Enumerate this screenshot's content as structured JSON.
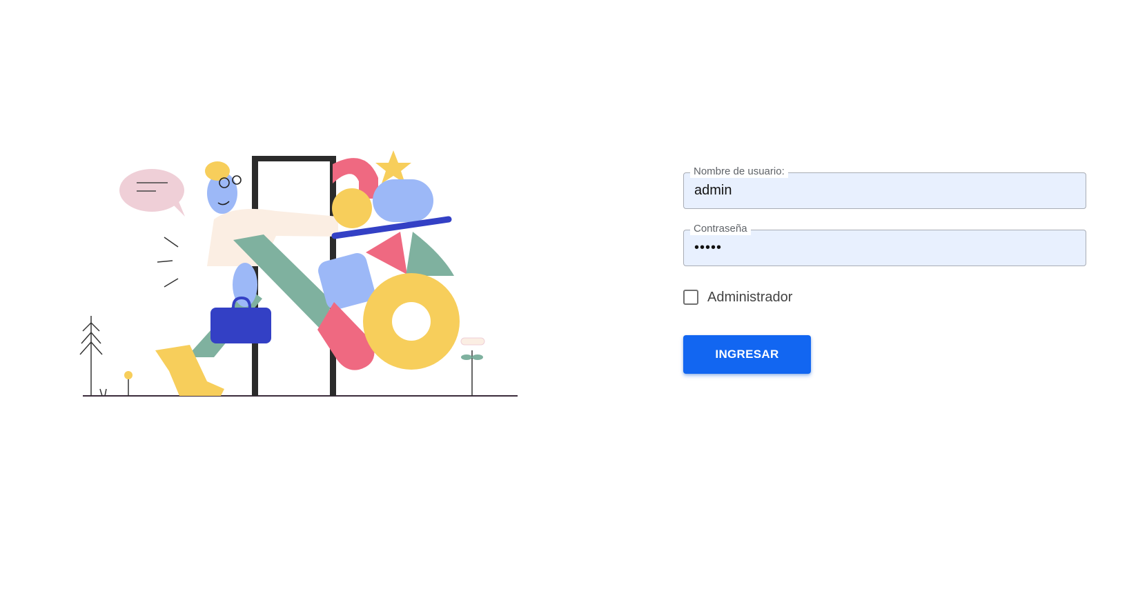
{
  "illustration": {
    "icon": "person-with-briefcase-and-shapes-illustration",
    "colors": {
      "pink": "#ef6981",
      "yellow": "#f7ce5b",
      "blue_light": "#9cb8f7",
      "blue_dark": "#3340c5",
      "green": "#7fb19f",
      "cream": "#fbeee3",
      "dark": "#2b2b2b"
    }
  },
  "form": {
    "username": {
      "label": "Nombre de usuario:",
      "value": "admin"
    },
    "password": {
      "label": "Contraseña",
      "value": "admin"
    },
    "admin_checkbox": {
      "label": "Administrador",
      "checked": false
    },
    "submit_label": "INGRESAR"
  },
  "colors": {
    "input_bg": "#e8f0fe",
    "input_border": "#a8acb4",
    "primary": "#1266f1"
  }
}
